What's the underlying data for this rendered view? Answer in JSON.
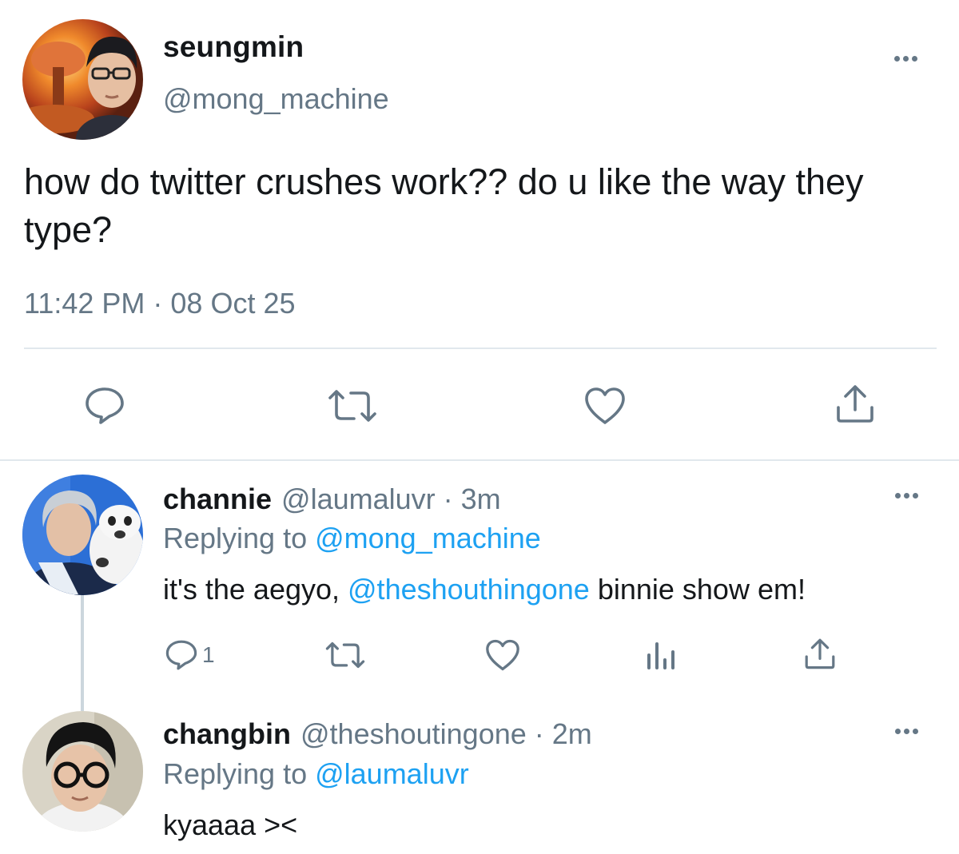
{
  "main_tweet": {
    "author": {
      "name": "seungmin",
      "handle": "@mong_machine"
    },
    "text": "how do twitter crushes work?? do u like the way they type?",
    "timestamp": "11:42 PM · 08 Oct 25",
    "actions": [
      "reply-icon",
      "retweet-icon",
      "like-icon",
      "share-icon"
    ]
  },
  "replies": [
    {
      "author": {
        "name": "channie",
        "handle": "@laumaluvr"
      },
      "time": "· 3m",
      "replying_prefix": "Replying to ",
      "replying_to": "@mong_machine",
      "text_before": "it's the aegyo, ",
      "mention": "@theshouthingone",
      "text_after": " binnie show em!",
      "reply_count": "1",
      "actions": [
        "reply-icon",
        "retweet-icon",
        "like-icon",
        "analytics-icon",
        "share-icon"
      ]
    },
    {
      "author": {
        "name": "changbin",
        "handle": "@theshoutingone"
      },
      "time": "· 2m",
      "replying_prefix": "Replying to ",
      "replying_to": "@laumaluvr",
      "text": "kyaaaa ><"
    }
  ],
  "colors": {
    "text": "#14171a",
    "muted": "#657786",
    "link": "#1da1f2",
    "divider": "#e1e8ed"
  }
}
